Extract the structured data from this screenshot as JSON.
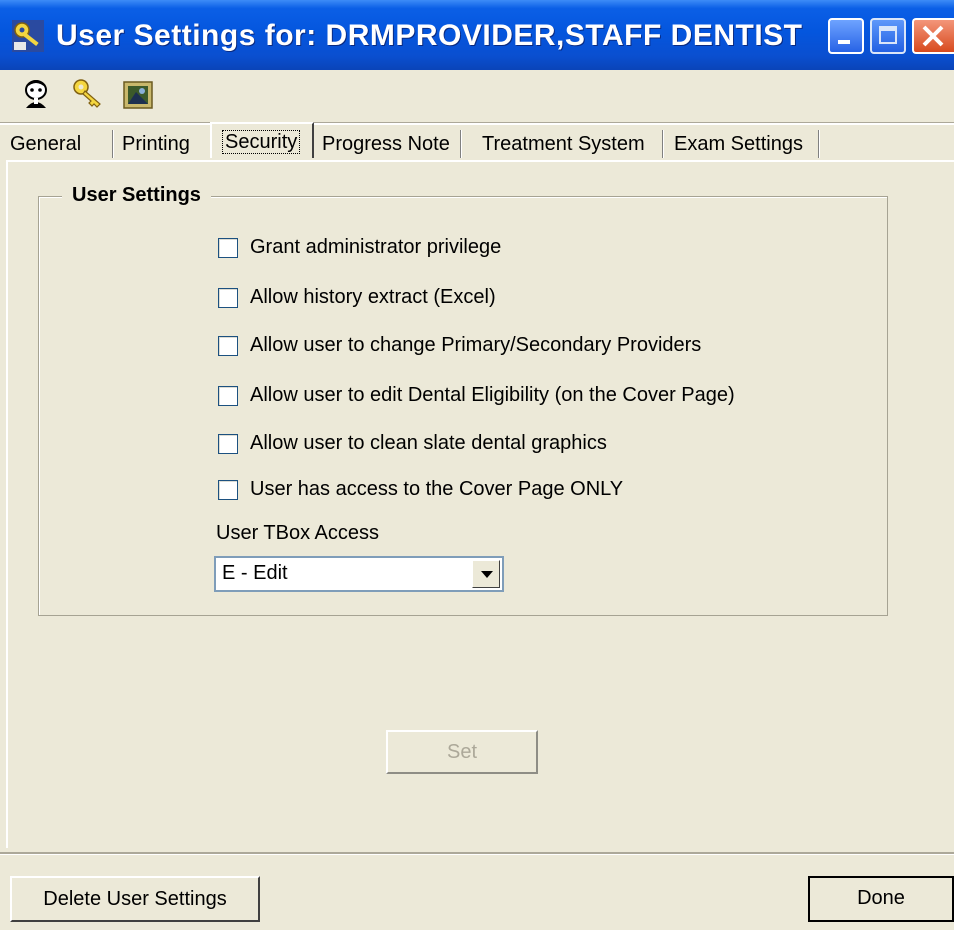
{
  "window": {
    "title": "User Settings for: DRMPROVIDER,STAFF DENTIST"
  },
  "toolbar": {
    "icons": [
      "user-avatar-icon",
      "key-icon",
      "image-icon"
    ]
  },
  "tabs": [
    {
      "label": "General"
    },
    {
      "label": "Printing"
    },
    {
      "label": "Security",
      "active": true
    },
    {
      "label": "Progress Note"
    },
    {
      "label": "Treatment System"
    },
    {
      "label": "Exam Settings"
    }
  ],
  "group": {
    "title": "User Settings"
  },
  "checkboxes": [
    {
      "label": "Grant administrator privilege",
      "checked": false
    },
    {
      "label": "Allow history extract (Excel)",
      "checked": false
    },
    {
      "label": "Allow user to change Primary/Secondary Providers",
      "checked": false
    },
    {
      "label": "Allow user to edit Dental Eligibility (on the Cover Page)",
      "checked": false
    },
    {
      "label": "Allow user to clean slate dental graphics",
      "checked": false
    },
    {
      "label": "User has access to the Cover Page ONLY",
      "checked": false
    }
  ],
  "tbox": {
    "label": "User TBox Access",
    "value": "E - Edit"
  },
  "buttons": {
    "set": "Set",
    "delete": "Delete User Settings",
    "done": "Done"
  }
}
